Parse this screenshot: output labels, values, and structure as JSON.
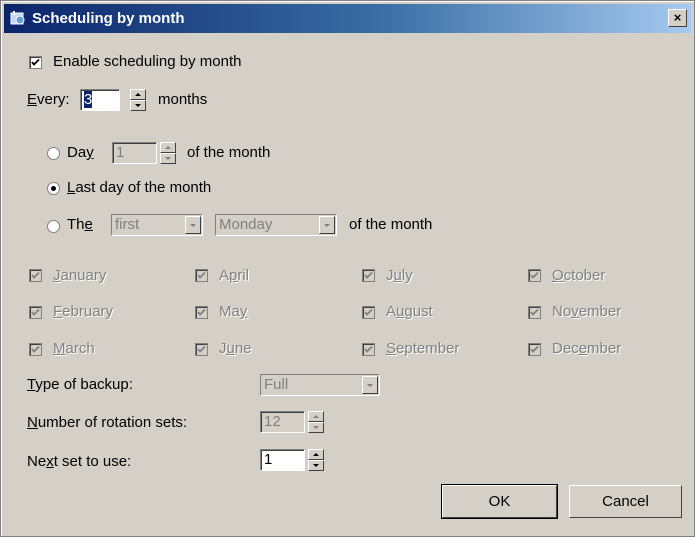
{
  "window": {
    "title": "Scheduling by month",
    "close_label": "×"
  },
  "enable": {
    "label": "Enable scheduling by month",
    "checked": true
  },
  "every": {
    "label": "Every:",
    "value": "3",
    "unit": "months"
  },
  "day_option": {
    "label": "Day",
    "value": "1",
    "suffix": "of the month",
    "selected": false
  },
  "last_day_option": {
    "label": "Last day of the month",
    "selected": true
  },
  "the_option": {
    "label": "The",
    "ordinal": "first",
    "weekday": "Monday",
    "suffix": "of the month",
    "selected": false
  },
  "months": [
    {
      "label": "January",
      "checked": true
    },
    {
      "label": "April",
      "checked": true
    },
    {
      "label": "July",
      "checked": true
    },
    {
      "label": "October",
      "checked": true
    },
    {
      "label": "February",
      "checked": true
    },
    {
      "label": "May",
      "checked": true
    },
    {
      "label": "August",
      "checked": true
    },
    {
      "label": "November",
      "checked": true
    },
    {
      "label": "March",
      "checked": true
    },
    {
      "label": "June",
      "checked": true
    },
    {
      "label": "September",
      "checked": true
    },
    {
      "label": "December",
      "checked": true
    }
  ],
  "backup_type": {
    "label": "Type of backup:",
    "value": "Full"
  },
  "rotation_sets": {
    "label": "Number of rotation sets:",
    "value": "12"
  },
  "next_set": {
    "label": "Next set to use:",
    "value": "1"
  },
  "buttons": {
    "ok": "OK",
    "cancel": "Cancel"
  }
}
